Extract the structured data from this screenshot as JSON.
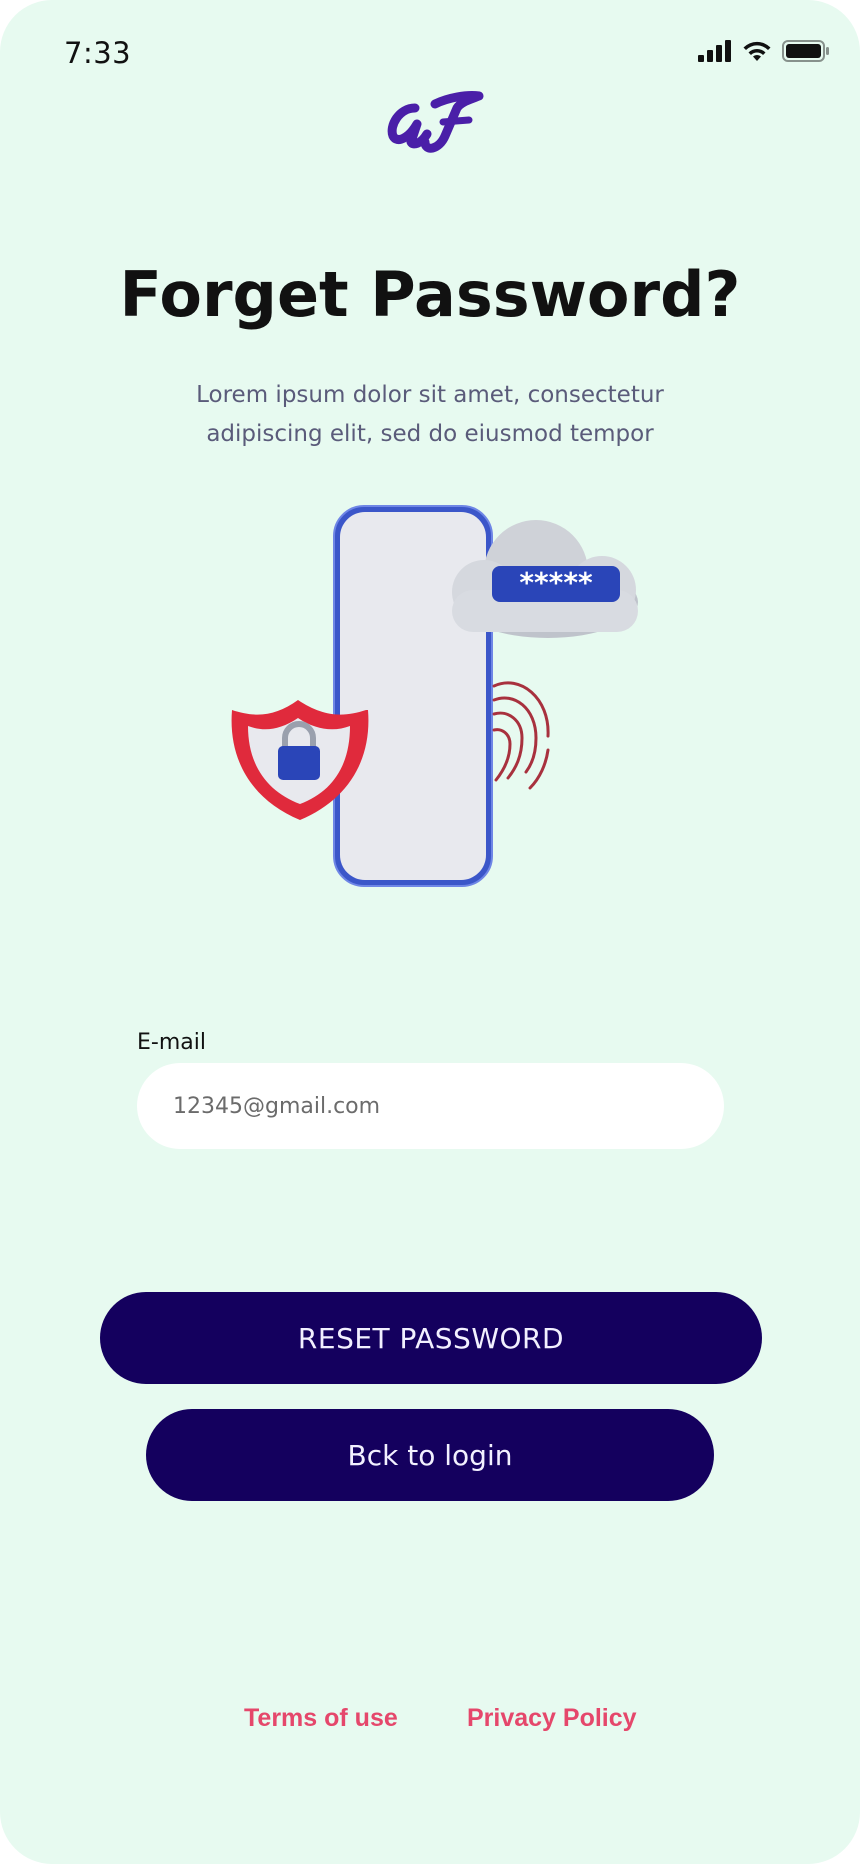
{
  "status_bar": {
    "time": "7:33",
    "icons": [
      "cellular-signal-icon",
      "wifi-icon",
      "battery-icon"
    ]
  },
  "brand": {
    "logo_icon": "aj-script-logo-icon",
    "logo_color": "#4a1fa8"
  },
  "header": {
    "title": "Forget Password?",
    "subtitle": "Lorem ipsum dolor sit amet, consectetur adipiscing elit, sed do eiusmod tempor"
  },
  "illustration": {
    "icons": [
      "phone-icon",
      "cloud-icon",
      "shield-lock-icon",
      "fingerprint-icon"
    ],
    "password_mask": "*****"
  },
  "form": {
    "email_label": "E-mail",
    "email_placeholder": "12345@gmail.com"
  },
  "actions": {
    "reset_label": "RESET PASSWORD",
    "back_label": "Bck to login"
  },
  "footer": {
    "terms_label": "Terms of use",
    "privacy_label": "Privacy Policy"
  },
  "colors": {
    "background": "#e7faf0",
    "primary_button": "#14005e",
    "link": "#e5476b"
  }
}
